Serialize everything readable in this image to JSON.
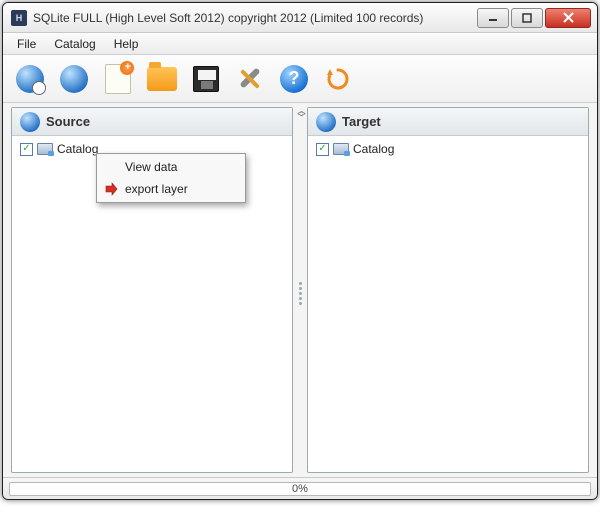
{
  "titlebar": {
    "title": "SQLite FULL    (High Level Soft 2012) copyright 2012  (Limited 100 records)"
  },
  "menu": {
    "items": [
      "File",
      "Catalog",
      "Help"
    ]
  },
  "toolbar": {
    "buttons": [
      {
        "name": "globe-clock-icon"
      },
      {
        "name": "globe-icon"
      },
      {
        "name": "new-document-icon"
      },
      {
        "name": "open-folder-icon"
      },
      {
        "name": "save-icon"
      },
      {
        "name": "tools-icon"
      },
      {
        "name": "help-icon"
      },
      {
        "name": "refresh-icon"
      }
    ]
  },
  "panels": {
    "source": {
      "header": "Source",
      "root": {
        "label": "Catalog",
        "checked": true
      }
    },
    "target": {
      "header": "Target",
      "root": {
        "label": "Catalog",
        "checked": true
      }
    }
  },
  "context_menu": {
    "items": [
      {
        "label": "View data",
        "icon": ""
      },
      {
        "label": "export layer",
        "icon": "export"
      }
    ]
  },
  "status": {
    "progress_text": "0%"
  }
}
